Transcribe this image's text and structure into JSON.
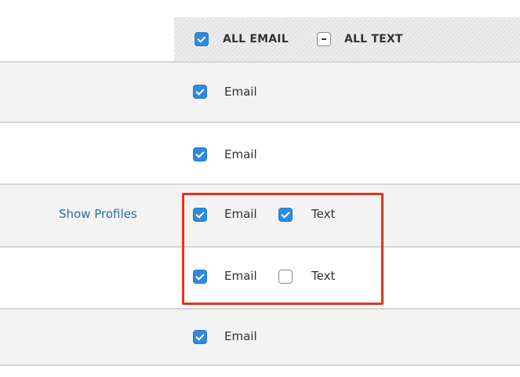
{
  "header": {
    "all_email_label": "ALL EMAIL",
    "all_email_state": "checked",
    "all_text_label": "ALL TEXT",
    "all_text_state": "indeterminate"
  },
  "rows": [
    {
      "email_label": "Email",
      "email_state": "checked"
    },
    {
      "email_label": "Email",
      "email_state": "checked"
    },
    {
      "link_label": "Show Profiles",
      "email_label": "Email",
      "email_state": "checked",
      "text_label": "Text",
      "text_state": "checked"
    },
    {
      "email_label": "Email",
      "email_state": "checked",
      "text_label": "Text",
      "text_state": "unchecked"
    },
    {
      "email_label": "Email",
      "email_state": "checked"
    }
  ],
  "colors": {
    "checkbox_checked": "#2f8ae0",
    "link": "#2b6f9e",
    "highlight_border": "#e8321e"
  }
}
